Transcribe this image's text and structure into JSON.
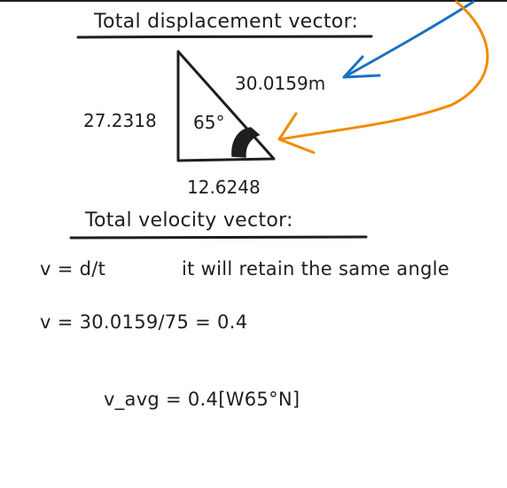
{
  "heading_displacement": "Total displacement vector:",
  "triangle": {
    "hypotenuse_label": "30.0159m",
    "vertical_label": "27.2318",
    "base_label": "12.6248",
    "angle_label": "65°"
  },
  "heading_velocity": "Total velocity vector:",
  "equations": {
    "velocity_formula": "v = d/t",
    "angle_note": "it will retain the same angle",
    "velocity_calc": "v = 30.0159/75 = 0.4",
    "velocity_result": "v_avg = 0.4[W65°N]"
  },
  "colors": {
    "ink": "#1e1e1e",
    "blue_arrow": "#1971c2",
    "orange_arrow": "#f08c00"
  }
}
